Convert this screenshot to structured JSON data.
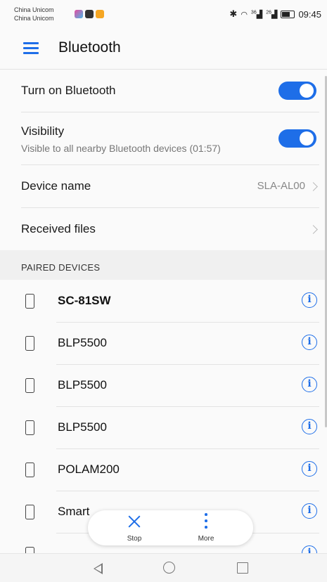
{
  "status_bar": {
    "carrier_1": "China Unicom",
    "carrier_2": "China Unicom",
    "signal_1": "36",
    "signal_2": "26",
    "time": "09:45",
    "icons": [
      "bluetooth-icon",
      "wifi-icon",
      "signal-icon",
      "battery-icon"
    ]
  },
  "header": {
    "title": "Bluetooth",
    "menu_icon": "menu-icon"
  },
  "settings": {
    "turn_on_label": "Turn on Bluetooth",
    "turn_on_enabled": true,
    "visibility_label": "Visibility",
    "visibility_sub": "Visible to all nearby Bluetooth devices (01:57)",
    "visibility_enabled": true,
    "device_name_label": "Device name",
    "device_name_value": "SLA-AL00",
    "received_files_label": "Received files"
  },
  "paired": {
    "section_title": "PAIRED DEVICES",
    "devices": [
      {
        "name": "SC-81SW",
        "bold": true
      },
      {
        "name": "BLP5500"
      },
      {
        "name": "BLP5500"
      },
      {
        "name": "BLP5500"
      },
      {
        "name": "POLAM200"
      },
      {
        "name": "Smart"
      }
    ]
  },
  "actions": {
    "stop_label": "Stop",
    "more_label": "More"
  },
  "colors": {
    "accent": "#1e6ee8"
  }
}
